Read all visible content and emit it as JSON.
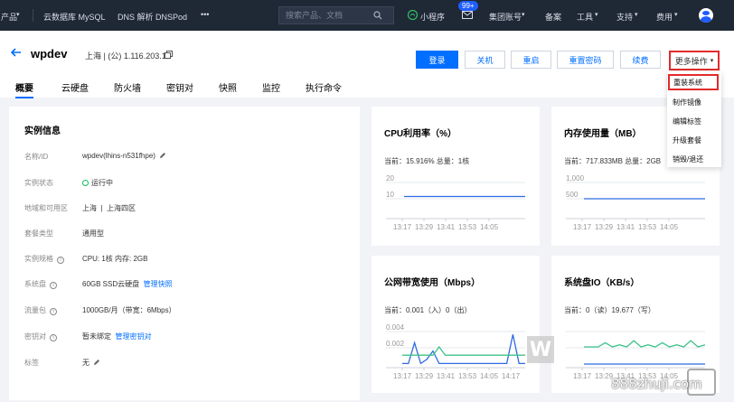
{
  "topnav": {
    "products": "产品",
    "mysql": "云数据库 MySQL",
    "dns": "DNS 解析 DNSPod",
    "more": "•••",
    "search_placeholder": "搜索产品、文档",
    "miniprogram": "小程序",
    "mail_badge": "99+",
    "account": "集团账号",
    "beian": "备案",
    "tools": "工具",
    "support": "支持",
    "fees": "费用"
  },
  "header": {
    "title": "wpdev",
    "location": "上海 | (公) 1.116.203.18",
    "buttons": {
      "login": "登录",
      "shutdown": "关机",
      "restart": "重启",
      "reset_password": "重置密码",
      "renew": "续费",
      "more_actions": "更多操作"
    },
    "tabs": [
      "概要",
      "云硬盘",
      "防火墙",
      "密钥对",
      "快照",
      "监控",
      "执行命令"
    ]
  },
  "dropdown": {
    "items": [
      "重装系统",
      "制作镜像",
      "编辑标签",
      "升级套餐",
      "销毁/退还"
    ]
  },
  "instance": {
    "title": "实例信息",
    "rows": [
      {
        "label": "名称/ID",
        "value": "wpdev(lhins-n531fhpe)"
      },
      {
        "label": "实例状态",
        "value": "运行中"
      },
      {
        "label": "地域和可用区",
        "value": "上海  |  上海四区"
      },
      {
        "label": "套餐类型",
        "value": "通用型"
      },
      {
        "label": "实例规格",
        "value": "CPU: 1核 内存: 2GB"
      },
      {
        "label": "系统盘",
        "value": "60GB SSD云硬盘",
        "link": "管理快照"
      },
      {
        "label": "流量包",
        "value": "1000GB/月（带宽：6Mbps）"
      },
      {
        "label": "密钥对",
        "value": "暂未绑定",
        "link": "管理密钥对"
      },
      {
        "label": "标签",
        "value": "无"
      }
    ]
  },
  "charts": {
    "cpu": {
      "title": "CPU利用率（%）",
      "current": "当前：15.916% 总量：1核"
    },
    "mem": {
      "title": "内存使用量（MB）",
      "current": "当前：717.833MB 总量：2GB"
    },
    "net": {
      "title": "公网带宽使用（Mbps）",
      "current": "当前：0.001（入）0（出）"
    },
    "disk": {
      "title": "系统盘IO（KB/s）",
      "current": "当前：0（读）19.677（写）"
    }
  },
  "chart_data": [
    {
      "type": "line",
      "title": "CPU利用率（%）",
      "x": [
        "13:17",
        "13:29",
        "13:41",
        "13:53",
        "14:05"
      ],
      "yticks": [
        "20",
        "10"
      ],
      "series": [
        {
          "values": [
            16,
            16,
            16,
            16,
            16,
            16,
            16,
            16,
            16,
            16,
            16,
            16
          ]
        }
      ]
    },
    {
      "type": "line",
      "title": "内存使用量（MB）",
      "x": [
        "13:17",
        "13:29",
        "13:41",
        "13:53",
        "14:05"
      ],
      "yticks": [
        "1,000",
        "500"
      ],
      "series": [
        {
          "values": [
            718,
            718,
            718,
            718,
            718,
            718,
            718,
            718,
            718,
            718,
            718,
            718
          ]
        }
      ]
    },
    {
      "type": "line",
      "title": "公网带宽使用（Mbps）",
      "x": [
        "13:17",
        "13:29",
        "13:41",
        "13:53",
        "14:05",
        "14:17"
      ],
      "yticks": [
        "0.004",
        "0.002"
      ],
      "series": [
        {
          "values": [
            0.0005,
            0.0005,
            0.003,
            0.0005,
            0.001,
            0.002,
            0.0005,
            0.0005,
            0.0005,
            0.0005,
            0.0005,
            0.0005,
            0.0005,
            0.0005,
            0.0005,
            0.0005,
            0.0005,
            0.0005,
            0.004,
            0.0005,
            0.0005
          ]
        },
        {
          "values": [
            0.0015,
            0.0015,
            0.0015,
            0.0015,
            0.0015,
            0.0015,
            0.0025,
            0.0015,
            0.0015,
            0.0015,
            0.0015,
            0.0015,
            0.0015,
            0.0015,
            0.0015,
            0.0015,
            0.0015,
            0.0015,
            0.0015,
            0.0015,
            0.0015
          ]
        }
      ]
    },
    {
      "type": "line",
      "title": "系统盘IO（KB/s）",
      "x": [
        "13:17",
        "13:29",
        "13:41",
        "13:53",
        "14:05"
      ],
      "yticks": [],
      "series": [
        {
          "values": [
            20,
            20,
            20,
            24,
            20,
            22,
            20,
            26,
            20,
            22,
            20,
            24,
            20,
            22,
            20,
            26,
            20,
            22
          ]
        }
      ]
    }
  ],
  "watermark": "888zhuji.com"
}
